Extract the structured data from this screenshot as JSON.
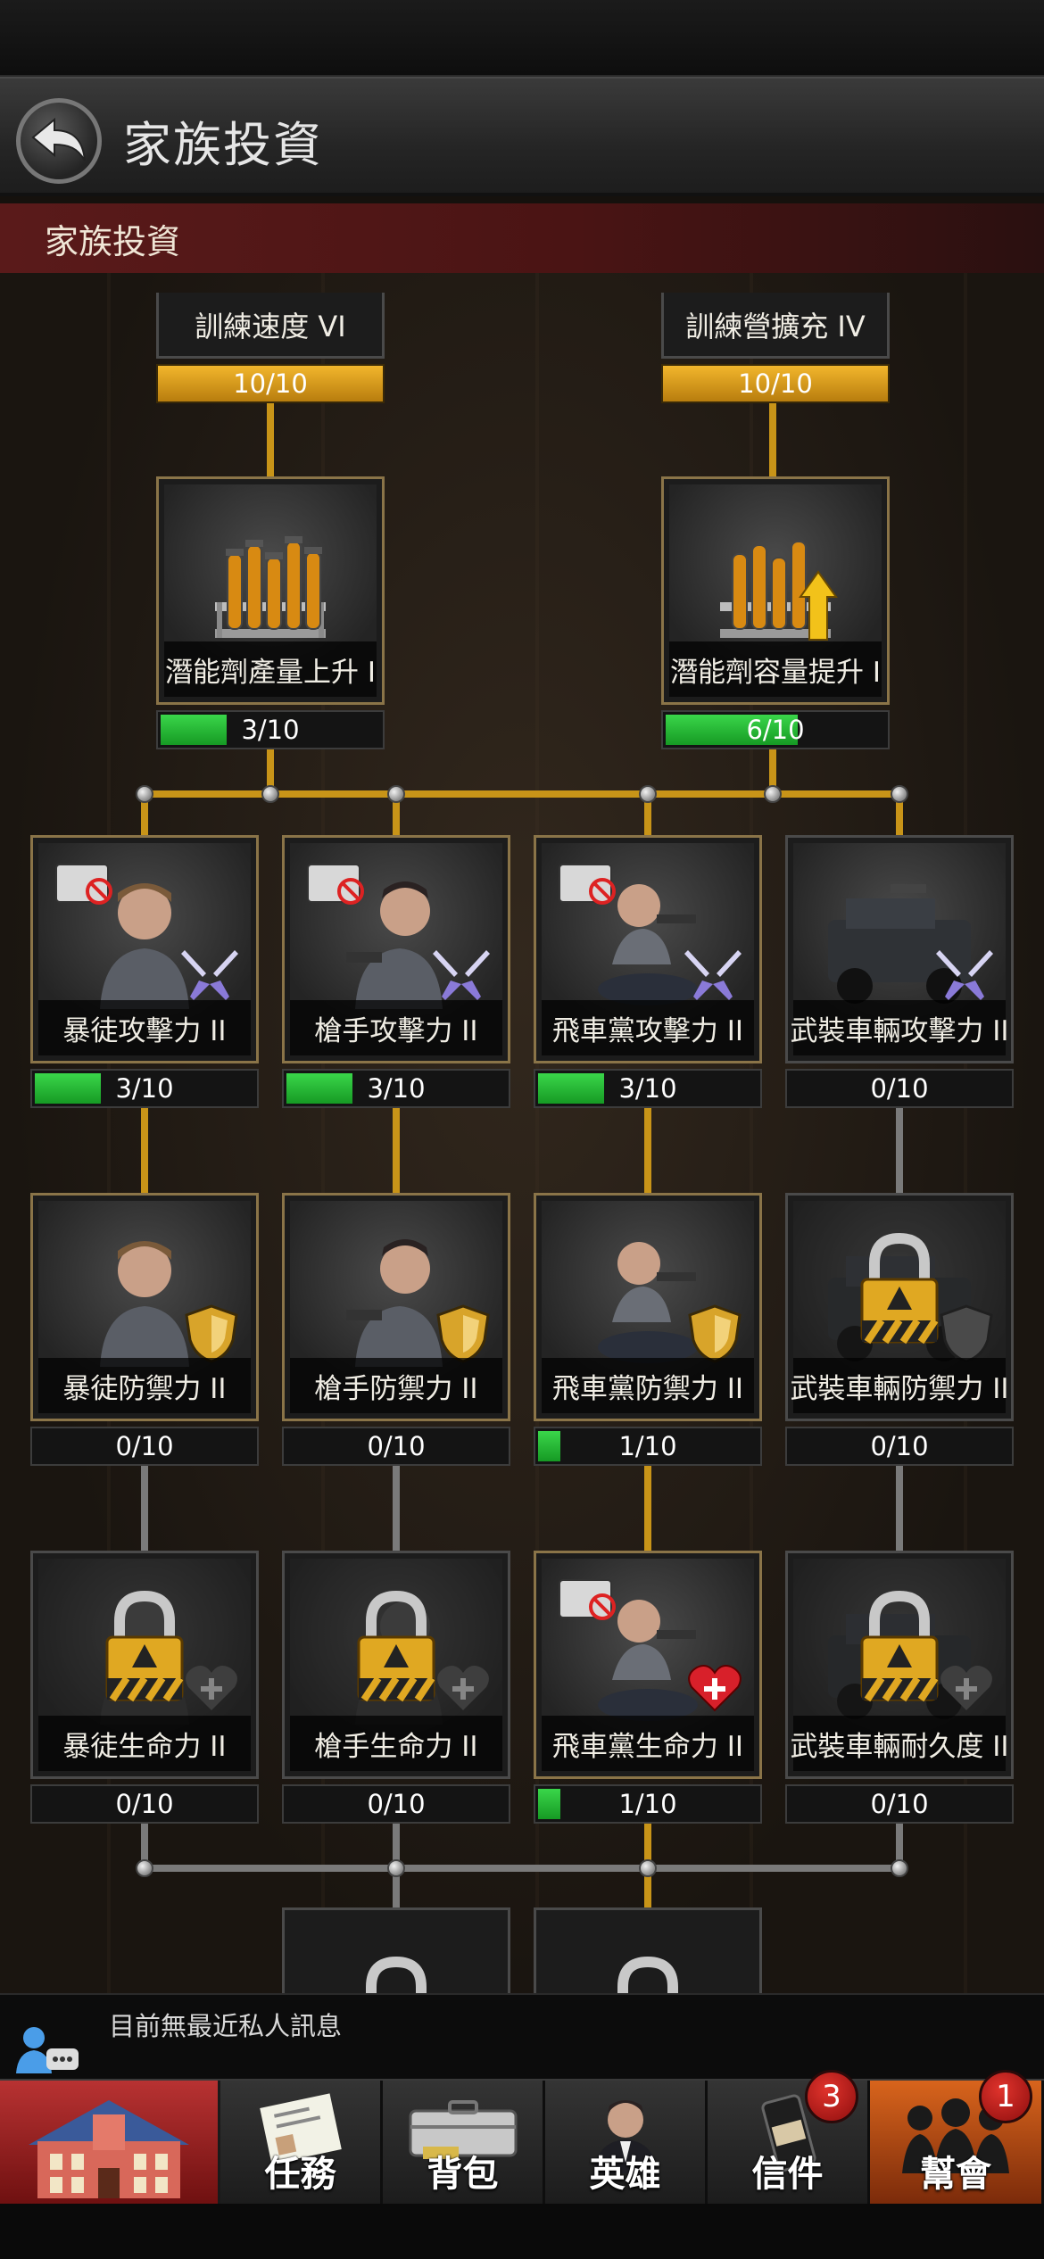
{
  "header": {
    "title": "家族投資"
  },
  "banner": {
    "title": "家族投資"
  },
  "top_nodes": [
    {
      "name": "訓練速度 VI",
      "progress": "10/10"
    },
    {
      "name": "訓練營擴充 IV",
      "progress": "10/10"
    }
  ],
  "potion_nodes": [
    {
      "name": "潛能劑產量上升 I",
      "progress": "3/10",
      "fill": 0.3
    },
    {
      "name": "潛能劑容量提升 I",
      "progress": "6/10",
      "fill": 0.6
    }
  ],
  "attack_row": [
    {
      "name": "暴徒攻擊力 II",
      "progress": "3/10",
      "fill": 0.3
    },
    {
      "name": "槍手攻擊力 II",
      "progress": "3/10",
      "fill": 0.3
    },
    {
      "name": "飛車黨攻擊力 II",
      "progress": "3/10",
      "fill": 0.3
    },
    {
      "name": "武裝車輛攻擊力 II",
      "progress": "0/10",
      "fill": 0
    }
  ],
  "defense_row": [
    {
      "name": "暴徒防禦力 II",
      "progress": "0/10",
      "fill": 0
    },
    {
      "name": "槍手防禦力 II",
      "progress": "0/10",
      "fill": 0
    },
    {
      "name": "飛車黨防禦力 II",
      "progress": "1/10",
      "fill": 0.1
    },
    {
      "name": "武裝車輛防禦力 II",
      "progress": "0/10",
      "fill": 0
    }
  ],
  "health_row": [
    {
      "name": "暴徒生命力 II",
      "progress": "0/10",
      "fill": 0
    },
    {
      "name": "槍手生命力 II",
      "progress": "0/10",
      "fill": 0
    },
    {
      "name": "飛車黨生命力 II",
      "progress": "1/10",
      "fill": 0.1
    },
    {
      "name": "武裝車輛耐久度 II",
      "progress": "0/10",
      "fill": 0
    }
  ],
  "message_bar": {
    "text": "目前無最近私人訊息"
  },
  "nav": {
    "tasks": "任務",
    "bag": "背包",
    "heroes": "英雄",
    "mail": "信件",
    "mail_badge": "3",
    "guild": "幫會",
    "guild_badge": "1"
  },
  "colors": {
    "gold_line": "#c89418",
    "grey_line": "#7a7a7a",
    "progress_green": "#2ec03c",
    "banner_red": "#5a1a1a"
  }
}
